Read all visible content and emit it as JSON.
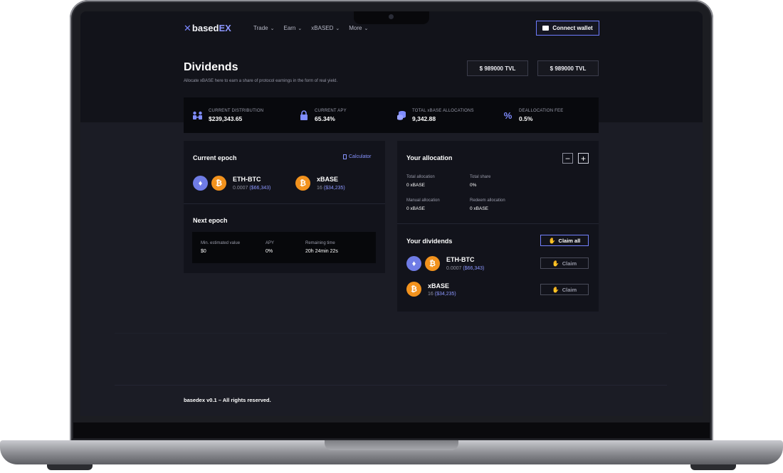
{
  "brand": {
    "prefix": "based",
    "suffix": "EX",
    "mark": "✕"
  },
  "nav": {
    "items": [
      {
        "label": "Trade"
      },
      {
        "label": "Earn"
      },
      {
        "label": "xBASED"
      },
      {
        "label": "More"
      }
    ],
    "connect_wallet": "Connect wallet"
  },
  "page": {
    "title": "Dividends",
    "subtitle": "Allocate xBASE here to earn a share of protocol earnings in the form of real yield.",
    "tvl": [
      "$ 989000 TVL",
      "$ 989000 TVL"
    ]
  },
  "stats": [
    {
      "label": "CURRENT DISTRIBUTION",
      "value": "$239,343.65",
      "icon": "people-icon"
    },
    {
      "label": "CURRENT APY",
      "value": "65.34%",
      "icon": "lock-icon"
    },
    {
      "label": "TOTAL xBASE ALLOCATIONS",
      "value": "9,342.88",
      "icon": "coins-icon"
    },
    {
      "label": "DEALLOCATION FEE",
      "value": "0.5%",
      "icon": "percent-icon"
    }
  ],
  "current_epoch": {
    "title": "Current epoch",
    "calculator": "Calculator",
    "assets": [
      {
        "name": "ETH-BTC",
        "amount": "0.0007",
        "usd": "($66,343)"
      },
      {
        "name": "xBASE",
        "amount": "16",
        "usd": "($34,235)"
      }
    ]
  },
  "next_epoch": {
    "title": "Next epoch",
    "fields": [
      {
        "label": "Min. estimated value",
        "value": "$0"
      },
      {
        "label": "APY",
        "value": "0%"
      },
      {
        "label": "Remaining time",
        "value": "20h 24min 22s"
      }
    ]
  },
  "allocation": {
    "title": "Your allocation",
    "minus": "−",
    "plus": "+",
    "fields": [
      {
        "label": "Total allocation",
        "value": "0 xBASE"
      },
      {
        "label": "Total share",
        "value": "0%"
      },
      {
        "label": "Manual allocation",
        "value": "0 xBASE"
      },
      {
        "label": "Redeem allocation",
        "value": "0 xBASE"
      }
    ]
  },
  "dividends": {
    "title": "Your dividends",
    "claim_all": "Claim all",
    "claim": "Claim",
    "items": [
      {
        "name": "ETH-BTC",
        "amount": "0.0007",
        "usd": "($66,343)"
      },
      {
        "name": "xBASE",
        "amount": "16",
        "usd": "($34,235)"
      }
    ]
  },
  "footer": "basedex v0.1 – All rights reserved.",
  "colors": {
    "accent": "#7b88ff",
    "eth": "#6f7ce6",
    "btc": "#f2921d",
    "background": "#12131a"
  }
}
